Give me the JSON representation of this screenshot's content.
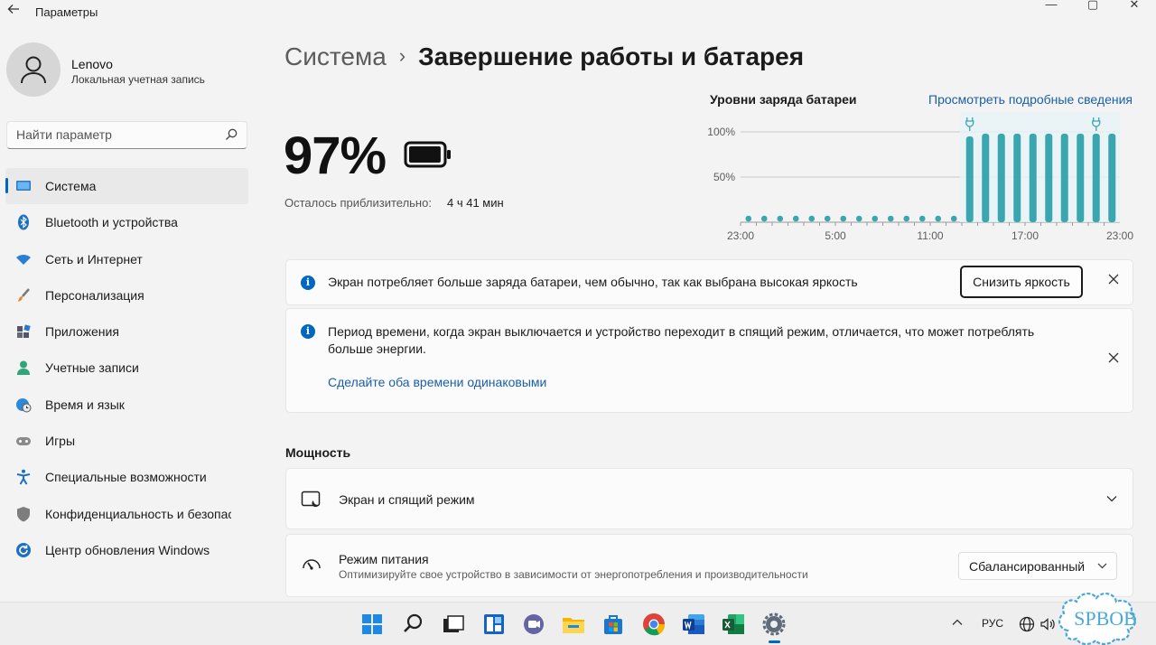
{
  "window": {
    "title": "Параметры",
    "controls": [
      "—",
      "▢",
      "✕"
    ]
  },
  "user": {
    "name": "Lenovo",
    "account_type": "Локальная учетная запись"
  },
  "search": {
    "placeholder": "Найти параметр"
  },
  "sidebar": {
    "items": [
      {
        "label": "Система",
        "icon": "system-icon",
        "active": true
      },
      {
        "label": "Bluetooth и устройства",
        "icon": "bluetooth-icon"
      },
      {
        "label": "Сеть и Интернет",
        "icon": "network-icon"
      },
      {
        "label": "Персонализация",
        "icon": "brush-icon"
      },
      {
        "label": "Приложения",
        "icon": "apps-icon"
      },
      {
        "label": "Учетные записи",
        "icon": "account-icon"
      },
      {
        "label": "Время и язык",
        "icon": "globe-clock-icon"
      },
      {
        "label": "Игры",
        "icon": "gamepad-icon"
      },
      {
        "label": "Специальные возможности",
        "icon": "accessibility-icon"
      },
      {
        "label": "Конфиденциальность и безопасность",
        "icon": "shield-icon"
      },
      {
        "label": "Центр обновления Windows",
        "icon": "update-icon"
      }
    ]
  },
  "breadcrumb": {
    "parent": "Система",
    "separator": "›",
    "current": "Завершение работы и батарея"
  },
  "battery": {
    "percent_text": "97%",
    "level": 0.97,
    "remaining_label": "Осталось приблизительно:",
    "remaining_value": "4 ч 41 мин"
  },
  "chart_header": {
    "title": "Уровни заряда батареи",
    "link": "Просмотреть подробные сведения"
  },
  "chart_data": {
    "type": "bar",
    "title": "Уровни заряда батареи",
    "y_tick_labels": [
      "100%",
      "50%"
    ],
    "x_tick_labels": [
      "23:00",
      "5:00",
      "11:00",
      "17:00",
      "23:00"
    ],
    "ylim": [
      0,
      100
    ],
    "values": [
      0,
      0,
      0,
      0,
      0,
      0,
      0,
      0,
      0,
      0,
      0,
      0,
      0,
      0,
      95,
      98,
      98,
      98,
      98,
      98,
      98,
      98,
      98,
      98
    ],
    "charging_markers": [
      14,
      22
    ],
    "grid": true,
    "color": "#3aa6b0"
  },
  "notice1": {
    "text": "Экран потребляет больше заряда батареи, чем обычно, так как выбрана высокая яркость",
    "button": "Снизить яркость"
  },
  "notice2": {
    "text_line1": "Период времени, когда экран выключается и устройство переходит в спящий режим, отличается, что может потреблять",
    "text_line2": "больше энергии.",
    "link": "Сделайте оба времени одинаковыми"
  },
  "power_section": {
    "heading": "Мощность",
    "screen_sleep": {
      "title": "Экран и спящий режим"
    },
    "power_mode": {
      "title": "Режим питания",
      "subtitle": "Оптимизируйте свое устройство в зависимости от энергопотребления и производительности",
      "value": "Сбалансированный"
    }
  },
  "taskbar": {
    "apps": [
      "start-icon",
      "search-icon",
      "task-view-icon",
      "widgets-icon",
      "teams-chat-icon",
      "file-explorer-icon",
      "store-icon",
      "chrome-icon",
      "word-icon",
      "excel-icon",
      "settings-icon"
    ],
    "language": "РУС"
  },
  "watermark": "SPBOB",
  "colors": {
    "accent": "#0067c0",
    "link": "#1a5fa8",
    "chart_bar": "#3aa6b0"
  }
}
